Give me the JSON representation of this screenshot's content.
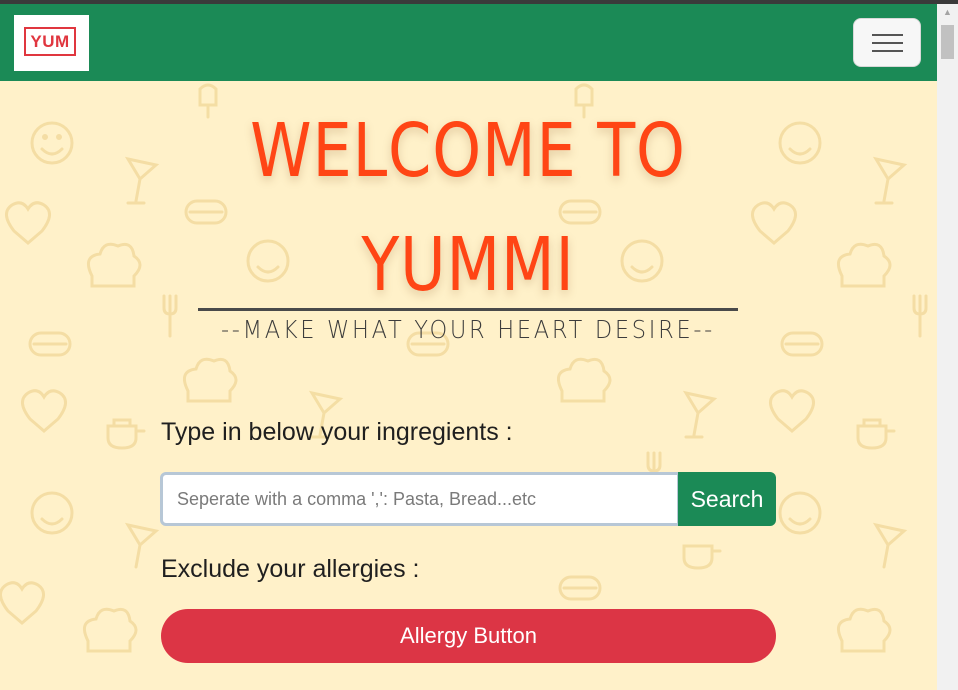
{
  "logo": {
    "text": "YUM",
    "color": "#e0363f"
  },
  "navbar": {
    "background": "#1b8a56",
    "menu_icon": "hamburger-icon"
  },
  "hero": {
    "title_line1": "WELCOME TO",
    "title_line2": "YUMMI",
    "subtitle": "--MAKE WHAT YOUR HEART DESIRE--",
    "title_color": "#ff4515"
  },
  "search": {
    "label": "Type in below your ingregients :",
    "placeholder": "Seperate with a comma ',': Pasta, Bread...etc",
    "button_label": "Search"
  },
  "allergies": {
    "label": "Exclude your allergies :",
    "button_label": "Allergy Button",
    "button_color": "#dc3545"
  },
  "background": {
    "color": "#fff1c9",
    "pattern": "food-doodle-pattern"
  },
  "scrollbar": {
    "arrow_icon": "scroll-up-arrow-icon"
  }
}
